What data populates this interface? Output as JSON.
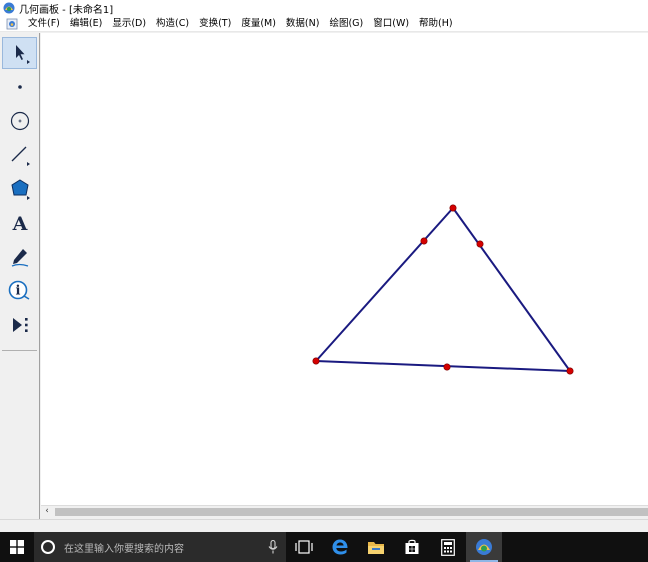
{
  "window": {
    "title": "几何画板 - [未命名1]"
  },
  "menu": [
    "文件(F)",
    "编辑(E)",
    "显示(D)",
    "构造(C)",
    "变换(T)",
    "度量(M)",
    "数据(N)",
    "绘图(G)",
    "窗口(W)",
    "帮助(H)"
  ],
  "toolbox": {
    "tools": [
      {
        "name": "selection-arrow",
        "icon": "arrow-icon",
        "active": true
      },
      {
        "name": "point",
        "icon": "point-icon"
      },
      {
        "name": "compass",
        "icon": "circle-icon"
      },
      {
        "name": "straightedge",
        "icon": "segment-icon"
      },
      {
        "name": "polygon",
        "icon": "polygon-icon"
      },
      {
        "name": "text",
        "icon": "text-icon",
        "label": "A"
      },
      {
        "name": "marker",
        "icon": "marker-icon"
      },
      {
        "name": "information",
        "icon": "info-icon",
        "label": "i"
      },
      {
        "name": "custom",
        "icon": "custom-tool-icon"
      }
    ]
  },
  "colors": {
    "segment": "#1a1a80",
    "point": "#d40000",
    "selected_tool": "#cfe0f3"
  },
  "taskbar": {
    "search_placeholder": "在这里输入你要搜索的内容",
    "pinned": [
      "task-view",
      "edge",
      "file-explorer",
      "store",
      "calculator",
      "geometers-sketchpad"
    ]
  }
}
